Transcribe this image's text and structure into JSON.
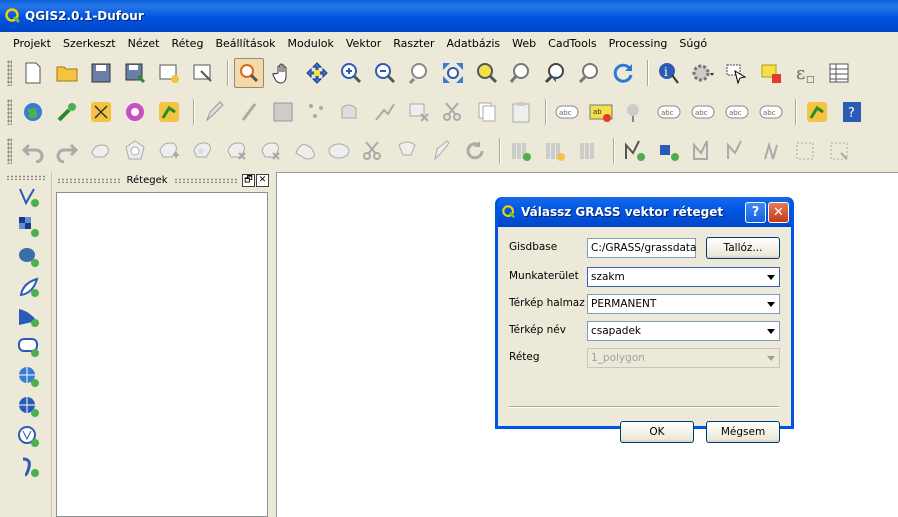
{
  "window": {
    "title": "QGIS2.0.1-Dufour"
  },
  "menu": [
    "Projekt",
    "Szerkeszt",
    "Nézet",
    "Réteg",
    "Beállítások",
    "Modulok",
    "Vektor",
    "Raszter",
    "Adatbázis",
    "Web",
    "CadTools",
    "Processing",
    "Súgó"
  ],
  "layers_panel": {
    "title": "Rétegek",
    "float_symbol": "🗗",
    "close_symbol": "✕"
  },
  "dialog": {
    "title": "Válassz GRASS vektor réteget",
    "help_symbol": "?",
    "close_symbol": "✕",
    "gisdbase": {
      "label": "Gisdbase",
      "value": "C:/GRASS/grassdata",
      "browse_label": "Tallóz..."
    },
    "location": {
      "label": "Munkaterület",
      "value": "szakm"
    },
    "mapset": {
      "label": "Térkép halmaz",
      "value": "PERMANENT"
    },
    "map": {
      "label": "Térkép név",
      "value": "csapadek"
    },
    "layer": {
      "label": "Réteg",
      "value": "1_polygon"
    },
    "ok_label": "OK",
    "cancel_label": "Mégsem"
  },
  "colors": {
    "titlebar": "#0054e3",
    "face": "#ece9d8",
    "accent": "#3d62b5"
  }
}
